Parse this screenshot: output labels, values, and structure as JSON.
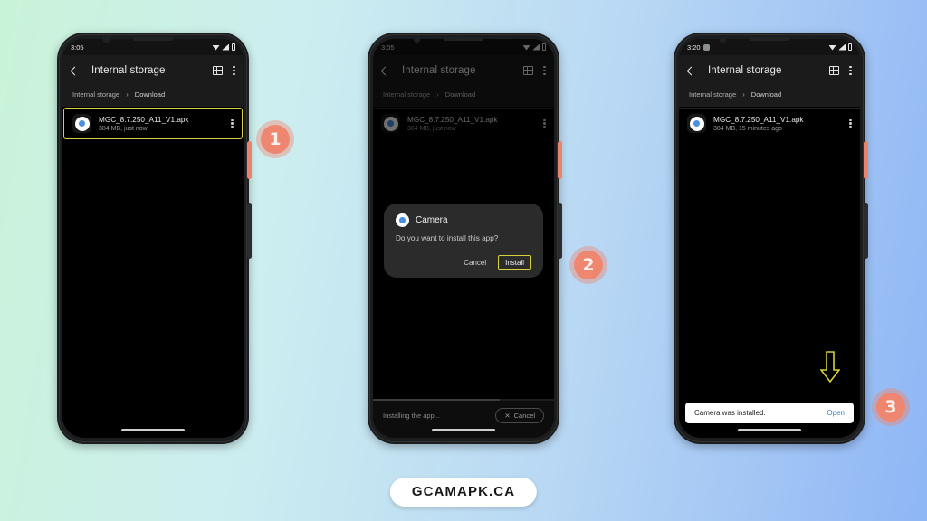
{
  "background": {
    "from": "#c9f3d8",
    "to": "#8fb6f5"
  },
  "accent": {
    "badge": "#ef8670",
    "highlight": "#d6d13c",
    "link": "#3b7ddd"
  },
  "footer": {
    "label": "GCAMAPK.CA"
  },
  "phones": [
    {
      "id": "phone-1",
      "status": {
        "time": "3:05",
        "wifi": "wifi-icon",
        "signal": "signal-icon",
        "battery": "battery-icon"
      },
      "appbar": {
        "back": "back-arrow-icon",
        "title": "Internal storage",
        "grid": "grid-view-icon",
        "more": "overflow-menu-icon"
      },
      "breadcrumb": {
        "root": "Internal storage",
        "separator": "›",
        "current": "Download"
      },
      "file": {
        "name": "MGC_8.7.250_A11_V1.apk",
        "meta": "384 MB, just now",
        "icon": "camera-app-icon"
      }
    },
    {
      "id": "phone-2",
      "status": {
        "time": "3:05",
        "wifi": "wifi-icon",
        "signal": "signal-icon",
        "battery": "battery-icon"
      },
      "appbar": {
        "back": "back-arrow-icon",
        "title": "Internal storage",
        "grid": "grid-view-icon",
        "more": "overflow-menu-icon"
      },
      "breadcrumb": {
        "root": "Internal storage",
        "separator": "›",
        "current": "Download"
      },
      "file": {
        "name": "MGC_8.7.250_A11_V1.apk",
        "meta": "384 MB, just now",
        "icon": "camera-app-icon"
      },
      "dialog": {
        "app_name": "Camera",
        "message": "Do you want to install this app?",
        "cancel": "Cancel",
        "install": "Install"
      },
      "progress": {
        "text": "Installing the app...",
        "cancel": "Cancel",
        "percent": 70
      }
    },
    {
      "id": "phone-3",
      "status": {
        "time": "3:20",
        "app": "app-notification-icon",
        "wifi": "wifi-icon",
        "signal": "signal-icon",
        "battery": "battery-icon"
      },
      "appbar": {
        "back": "back-arrow-icon",
        "title": "Internal storage",
        "grid": "grid-view-icon",
        "more": "overflow-menu-icon"
      },
      "breadcrumb": {
        "root": "Internal storage",
        "separator": "›",
        "current": "Download"
      },
      "file": {
        "name": "MGC_8.7.250_A11_V1.apk",
        "meta": "384 MB, 15 minutes ago",
        "icon": "camera-app-icon"
      },
      "snackbar": {
        "text": "Camera was installed.",
        "action": "Open"
      }
    }
  ],
  "badges": [
    {
      "label": "1"
    },
    {
      "label": "2"
    },
    {
      "label": "3"
    }
  ]
}
